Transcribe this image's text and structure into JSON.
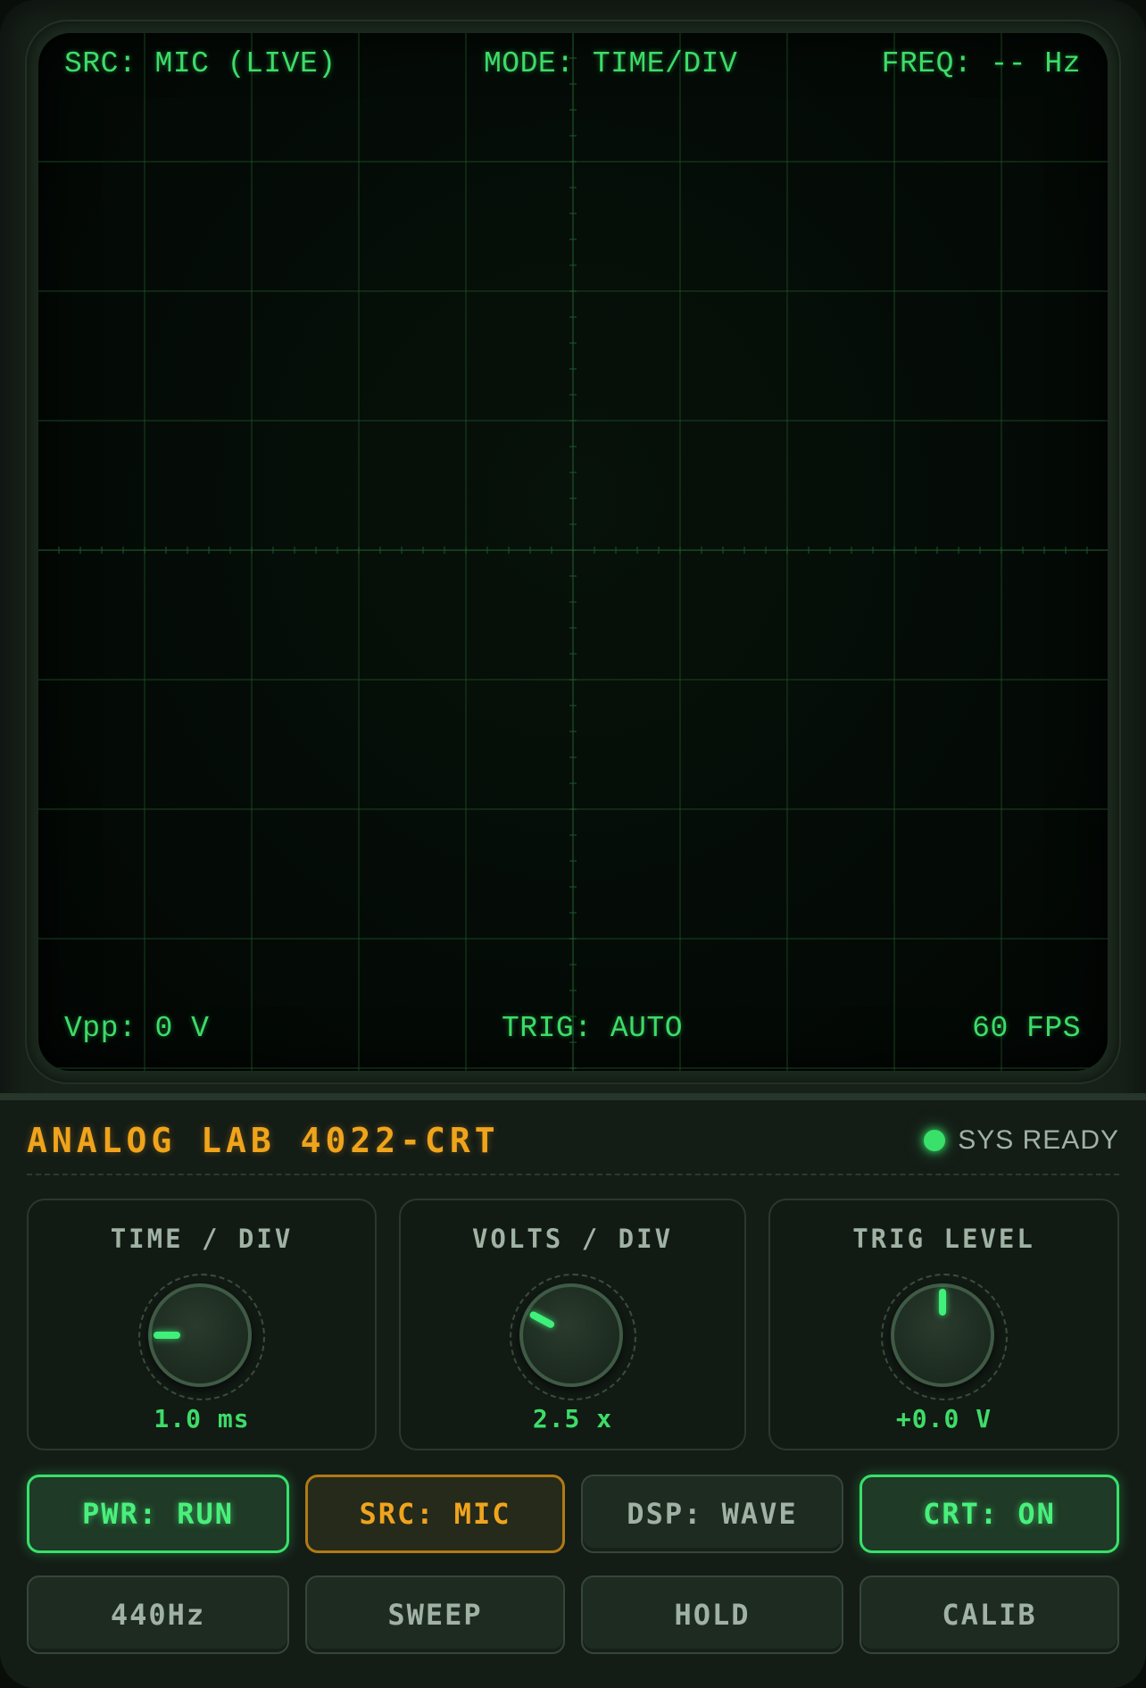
{
  "screen": {
    "src_label": "SRC: MIC (LIVE)",
    "mode_label": "MODE: TIME/DIV",
    "freq_label": "FREQ: -- Hz",
    "vpp_label": "Vpp: 0 V",
    "trig_label": "TRIG: AUTO",
    "fps_label": "60 FPS"
  },
  "panel": {
    "brand": "ANALOG LAB 4022-CRT",
    "status": "SYS READY",
    "knobs": [
      {
        "title": "TIME / DIV",
        "value": "1.0 ms",
        "pointer_deg": -90
      },
      {
        "title": "VOLTS / DIV",
        "value": "2.5 x",
        "pointer_deg": -62
      },
      {
        "title": "TRIG LEVEL",
        "value": "+0.0 V",
        "pointer_deg": 0
      }
    ],
    "buttons_row1": [
      "PWR: RUN",
      "SRC: MIC",
      "DSP: WAVE",
      "CRT: ON"
    ],
    "buttons_row2": [
      "440Hz",
      "SWEEP",
      "HOLD",
      "CALIB"
    ]
  },
  "colors": {
    "phosphor": "#3ddc68",
    "amber": "#f0a41c",
    "panel": "#141c16"
  }
}
